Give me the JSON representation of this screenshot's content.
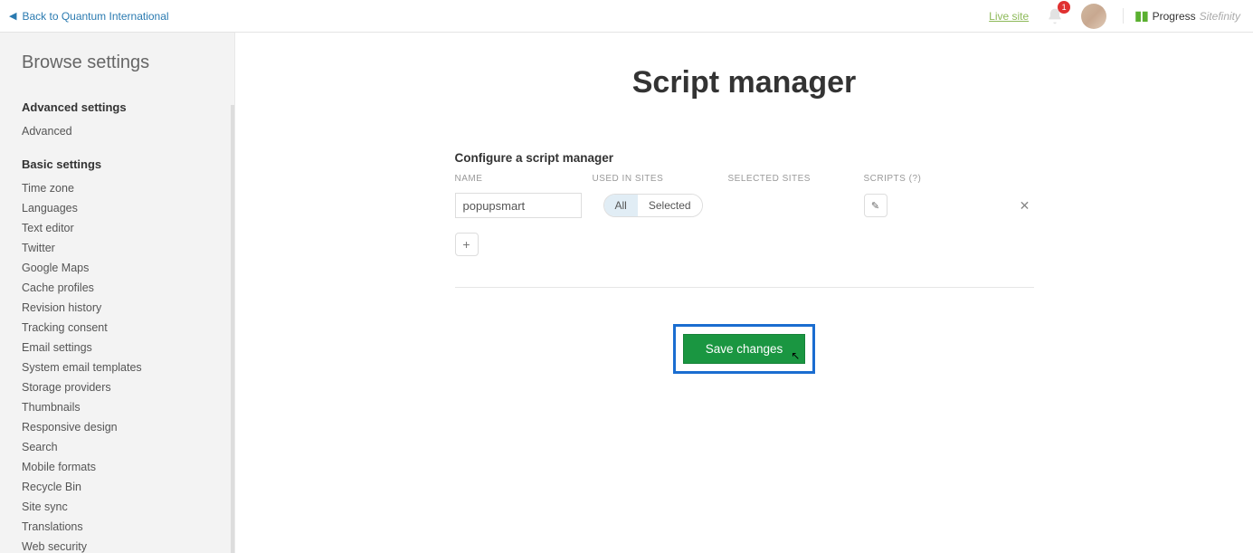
{
  "topbar": {
    "back_text": "Back to Quantum International",
    "live_site": "Live site",
    "notif_count": "1",
    "brand": "Progress",
    "brand_sub": "Sitefinity"
  },
  "sidebar": {
    "browse_title": "Browse settings",
    "advanced_head": "Advanced settings",
    "advanced_items": [
      "Advanced"
    ],
    "basic_head": "Basic settings",
    "basic_items": [
      "Time zone",
      "Languages",
      "Text editor",
      "Twitter",
      "Google Maps",
      "Cache profiles",
      "Revision history",
      "Tracking consent",
      "Email settings",
      "System email templates",
      "Storage providers",
      "Thumbnails",
      "Responsive design",
      "Search",
      "Mobile formats",
      "Recycle Bin",
      "Site sync",
      "Translations",
      "Web security"
    ]
  },
  "main": {
    "title": "Script manager",
    "panel_label": "Configure a script manager",
    "headers": {
      "name": "NAME",
      "used": "USED IN SITES",
      "selected": "SELECTED SITES",
      "scripts": "SCRIPTS (?)"
    },
    "row": {
      "name_value": "popupsmart",
      "seg_all": "All",
      "seg_selected": "Selected"
    },
    "save_label": "Save changes"
  }
}
